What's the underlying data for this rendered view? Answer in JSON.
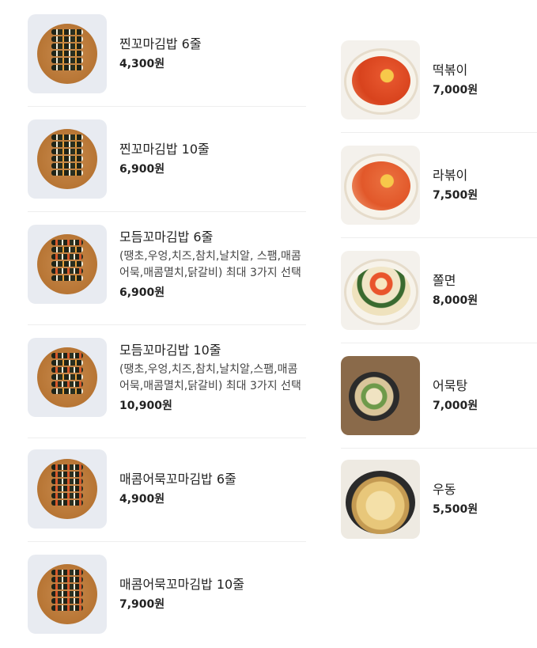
{
  "left_menu": [
    {
      "name": "찐꼬마김밥 6줄",
      "description": "",
      "price": "4,300원"
    },
    {
      "name": "찐꼬마김밥 10줄",
      "description": "",
      "price": "6,900원"
    },
    {
      "name": "모듬꼬마김밥 6줄",
      "description": "(땡초,우엉,치즈,참치,날치알, 스팸,매콤어묵,매콤멸치,닭갈비) 최대 3가지 선택",
      "price": "6,900원"
    },
    {
      "name": "모듬꼬마김밥 10줄",
      "description": "(땡초,우엉,치즈,참치,날치알,스팸,매콤어묵,매콤멸치,닭갈비) 최대 3가지 선택",
      "price": "10,900원"
    },
    {
      "name": "매콤어묵꼬마김밥 6줄",
      "description": "",
      "price": "4,900원"
    },
    {
      "name": "매콤어묵꼬마김밥 10줄",
      "description": "",
      "price": "7,900원"
    }
  ],
  "right_menu": [
    {
      "name": "떡볶이",
      "price": "7,000원"
    },
    {
      "name": "라볶이",
      "price": "7,500원"
    },
    {
      "name": "쫄면",
      "price": "8,000원"
    },
    {
      "name": "어묵탕",
      "price": "7,000원"
    },
    {
      "name": "우동",
      "price": "5,500원"
    }
  ]
}
